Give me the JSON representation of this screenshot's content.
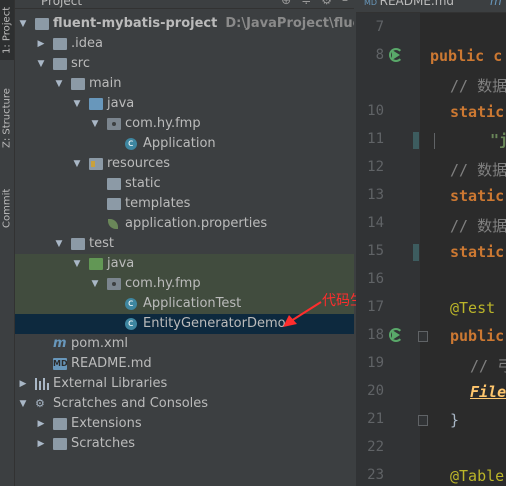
{
  "sidebar_tabs": [
    {
      "label": "1: Project",
      "active": true
    },
    {
      "label": "Z: Structure",
      "active": false
    },
    {
      "label": "Commit",
      "active": false
    }
  ],
  "panel": {
    "title": "Project"
  },
  "tree": [
    {
      "label": "fluent-mybatis-project",
      "path": "D:\\JavaProject\\fluent-mybat"
    },
    {
      "label": ".idea"
    },
    {
      "label": "src"
    },
    {
      "label": "main"
    },
    {
      "label": "java"
    },
    {
      "label": "com.hy.fmp"
    },
    {
      "label": "Application"
    },
    {
      "label": "resources"
    },
    {
      "label": "static"
    },
    {
      "label": "templates"
    },
    {
      "label": "application.properties"
    },
    {
      "label": "test"
    },
    {
      "label": "java"
    },
    {
      "label": "com.hy.fmp"
    },
    {
      "label": "ApplicationTest"
    },
    {
      "label": "EntityGeneratorDemo"
    },
    {
      "label": "pom.xml"
    },
    {
      "label": "README.md"
    },
    {
      "label": "External Libraries"
    },
    {
      "label": "Scratches and Consoles"
    },
    {
      "label": "Extensions"
    },
    {
      "label": "Scratches"
    }
  ],
  "annotation": "代码生成工具",
  "editor": {
    "tabs": [
      "README.md"
    ],
    "line_numbers": [
      "7",
      "8",
      "10",
      "11",
      "12",
      "13",
      "14",
      "15",
      "16",
      "17",
      "18",
      "19",
      "20",
      "21",
      "22",
      "23"
    ],
    "lines": {
      "l8": "public c",
      "l10": "// 数据",
      "l11a": "static",
      "l11b": "\"j",
      "l12": "// 数据",
      "l13": "static",
      "l14": "// 数据",
      "l15": "static",
      "l17": "@Test",
      "l18": "public",
      "l19": "// 弓",
      "l20": "File",
      "l21": "}",
      "l23": "@Table"
    }
  },
  "colors": {
    "panel_bg": "#3c3f41",
    "editor_bg": "#2b2b2b",
    "selection": "#0d293e",
    "test_highlight": "#414c3e",
    "annotation": "#ff2d2d"
  }
}
